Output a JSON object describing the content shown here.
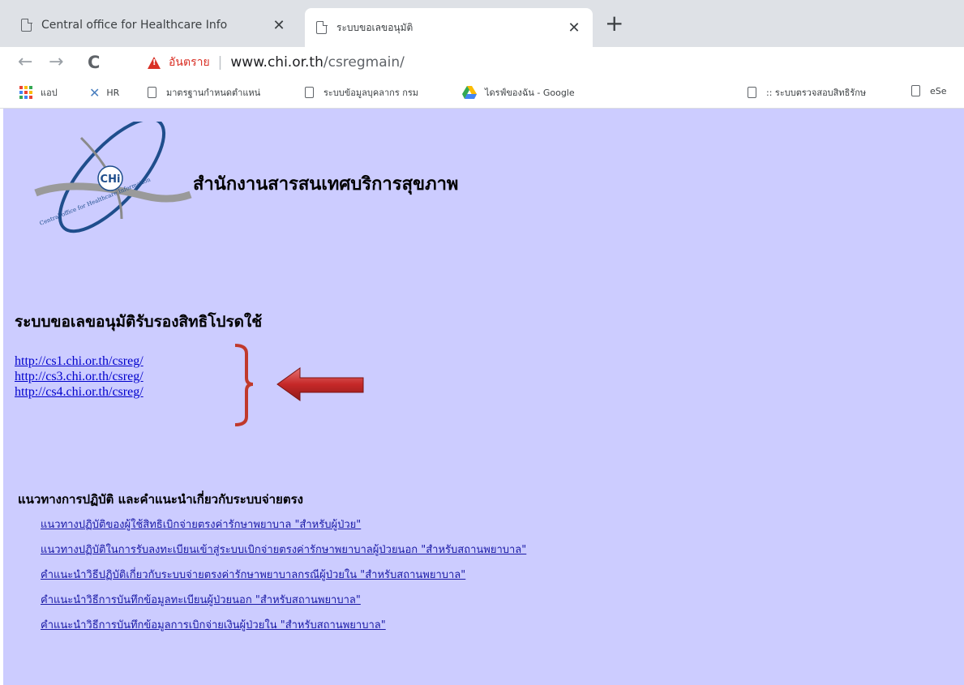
{
  "browser": {
    "tabs": [
      {
        "title": "Central office for Healthcare Info",
        "active": false
      },
      {
        "title": "ระบบขอเลขอนุมัติ",
        "active": true
      }
    ],
    "new_tab_label": "+",
    "close_glyph": "✕",
    "nav": {
      "back": "←",
      "forward": "→",
      "reload": "C"
    },
    "security_warning": "อันตราย",
    "url_host": "www.chi.or.th",
    "url_path": "/csregmain/",
    "bookmarks": [
      {
        "label": "แอป",
        "icon": "apps-icon"
      },
      {
        "label": "HR",
        "icon": "hr-icon"
      },
      {
        "label": "มาตรฐานกำหนดตำแหน่",
        "icon": "page-icon"
      },
      {
        "label": "ระบบข้อมูลบุคลากร กรม",
        "icon": "page-icon"
      },
      {
        "label": "ไดรฟ์ของฉัน - Google",
        "icon": "drive-icon"
      },
      {
        "label": ":: ระบบตรวจสอบสิทธิรักษ",
        "icon": "page-icon"
      },
      {
        "label": "eSe",
        "icon": "page-icon"
      }
    ]
  },
  "page": {
    "logo_text": "CHi",
    "logo_tagline": "Central office for Healthcare Information",
    "org_title": "สำนักงานสารสนเทศบริการสุขภาพ",
    "system_title": "ระบบขอเลขอนุมัติรับรองสิทธิโปรดใช้",
    "server_links": [
      "http://cs1.chi.or.th/csreg/",
      "http://cs3.chi.or.th/csreg/",
      "http://cs4.chi.or.th/csreg/"
    ],
    "guide_title": "แนวทางการปฏิบัติ และคำแนะนำเกี่ยวกับระบบจ่ายตรง",
    "guide_links": [
      "แนวทางปฏิบัติของผู้ใช้สิทธิเบิกจ่ายตรงค่ารักษาพยาบาล \"สำหรับผู้ป่วย\"",
      "แนวทางปฏิบัติในการรับลงทะเบียนเข้าสู่ระบบเบิกจ่ายตรงค่ารักษาพยาบาลผู้ป่วยนอก \"สำหรับสถานพยาบาล\"",
      "คำแนะนำวิธีปฏิบัติเกี่ยวกับระบบจ่ายตรงค่ารักษาพยาบาลกรณีผู้ป่วยใน \"สำหรับสถานพยาบาล\"",
      "คำแนะนำวิธีการบันทึกข้อมูลทะเบียนผู้ป่วยนอก \"สำหรับสถานพยาบาล\"",
      "คำแนะนำวิธีการบันทึกข้อมูลการเบิกจ่ายเงินผู้ป่วยใน \"สำหรับสถานพยาบาล\""
    ],
    "colors": {
      "page_bg": "#ccccff",
      "link": "#0000cc",
      "annotation": "#c0392b"
    }
  }
}
